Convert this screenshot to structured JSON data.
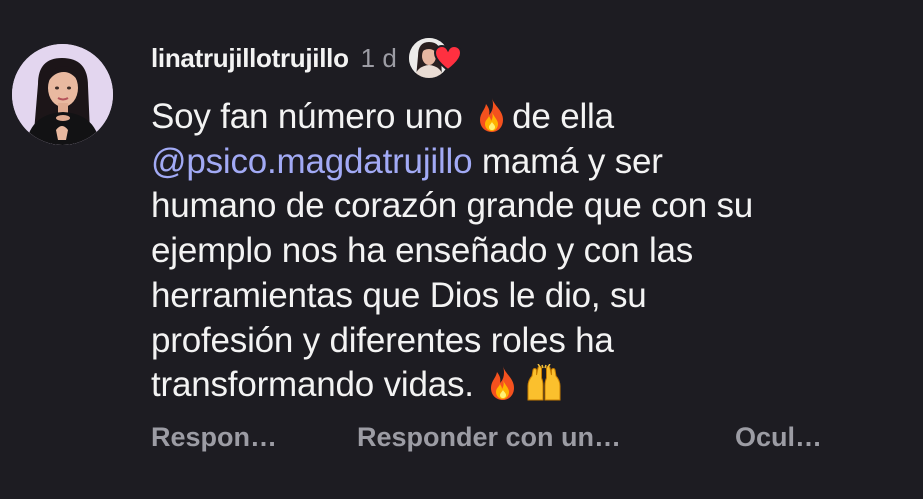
{
  "comment": {
    "username": "linatrujillotrujillo",
    "time_ago": "1 d",
    "liked_by_author_icon": "heart-icon",
    "body": {
      "line1_before": "Soy fan número uno ",
      "line1_after": "de ella",
      "mention": "@psico.magdatrujillo",
      "line2_after": " mamá y ser",
      "line3": "humano de corazón grande que con su",
      "line4": "ejemplo nos ha enseñado y con las",
      "line5": "herramientas que Dios le dio, su",
      "line6": "profesión y diferentes roles ha",
      "line7": "transformando vidas. ",
      "emojis": [
        "fire-emoji",
        "fire-emoji",
        "raising-hands-emoji"
      ]
    },
    "actions": {
      "reply": "Respon…",
      "reply_with": "Responder con un…",
      "hide": "Ocul…"
    }
  },
  "colors": {
    "background": "#1d1c22",
    "text": "#f3f3f3",
    "muted": "#9c9ca4",
    "mention": "#a2aaf5",
    "heart": "#ff3040"
  }
}
